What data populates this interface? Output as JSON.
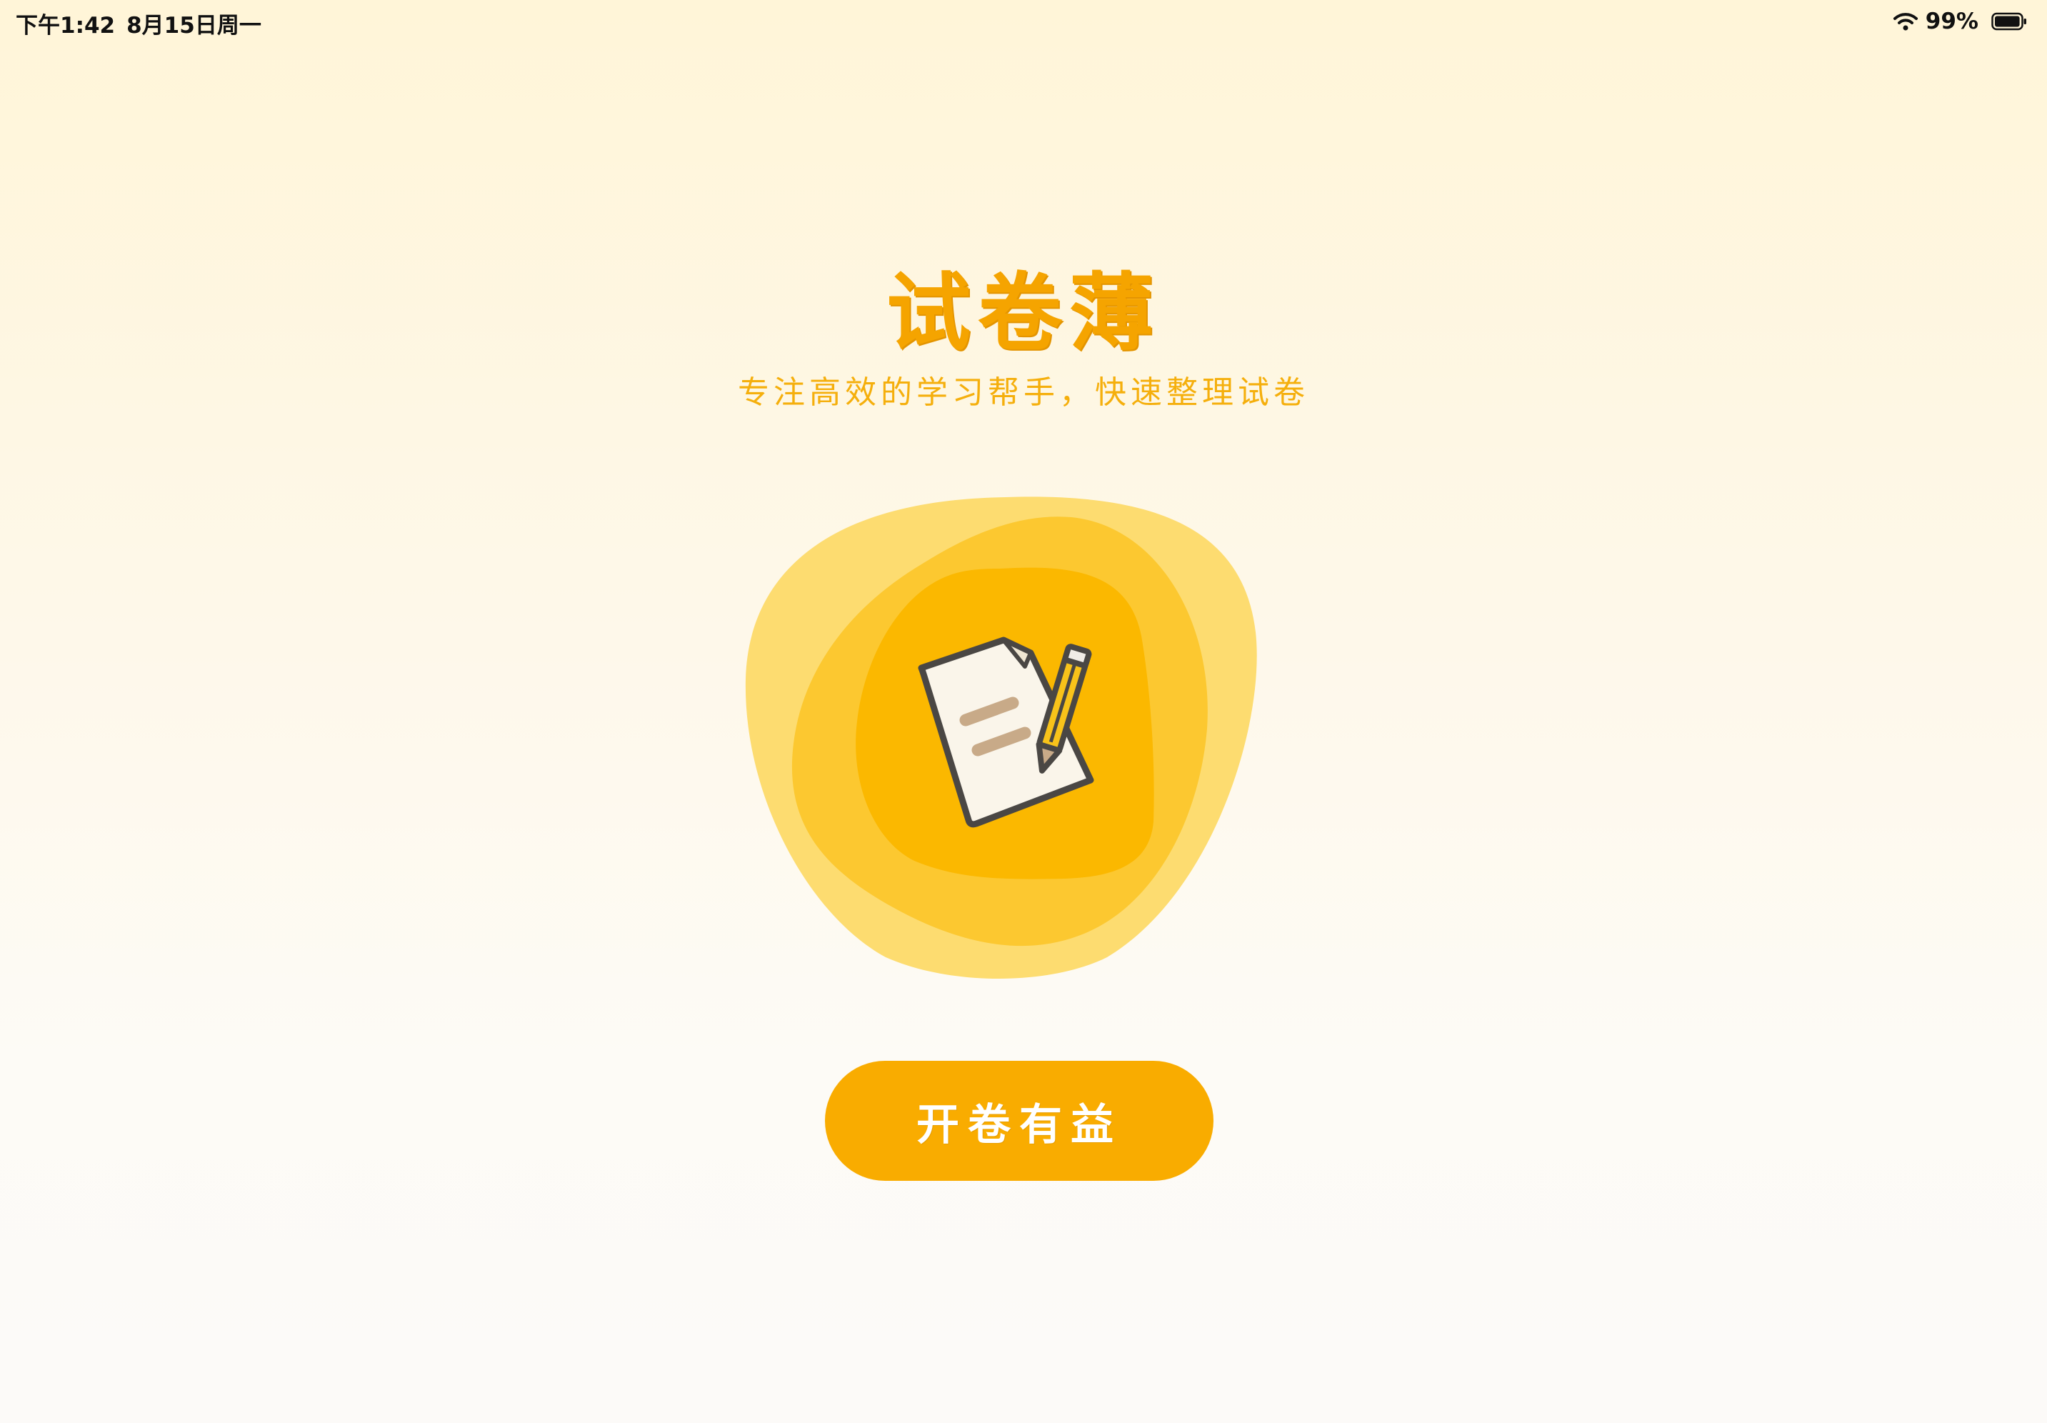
{
  "status_bar": {
    "time": "下午1:42",
    "date": "8月15日周一",
    "battery_percent": "99%",
    "battery_level": 0.99,
    "icons": [
      "wifi-icon",
      "battery-icon"
    ]
  },
  "app": {
    "title": "试卷薄",
    "subtitle": "专注高效的学习帮手，快速整理试卷"
  },
  "hero": {
    "icon": "document-pencil-icon"
  },
  "actions": {
    "start_label": "开卷有益"
  },
  "colors": {
    "accent": "#F9AC00",
    "title": "#F5A400",
    "subtitle": "#F5AF0C",
    "blob_outer": "#FDDC70",
    "blob_middle": "#FCC830",
    "blob_inner": "#FBB800"
  }
}
